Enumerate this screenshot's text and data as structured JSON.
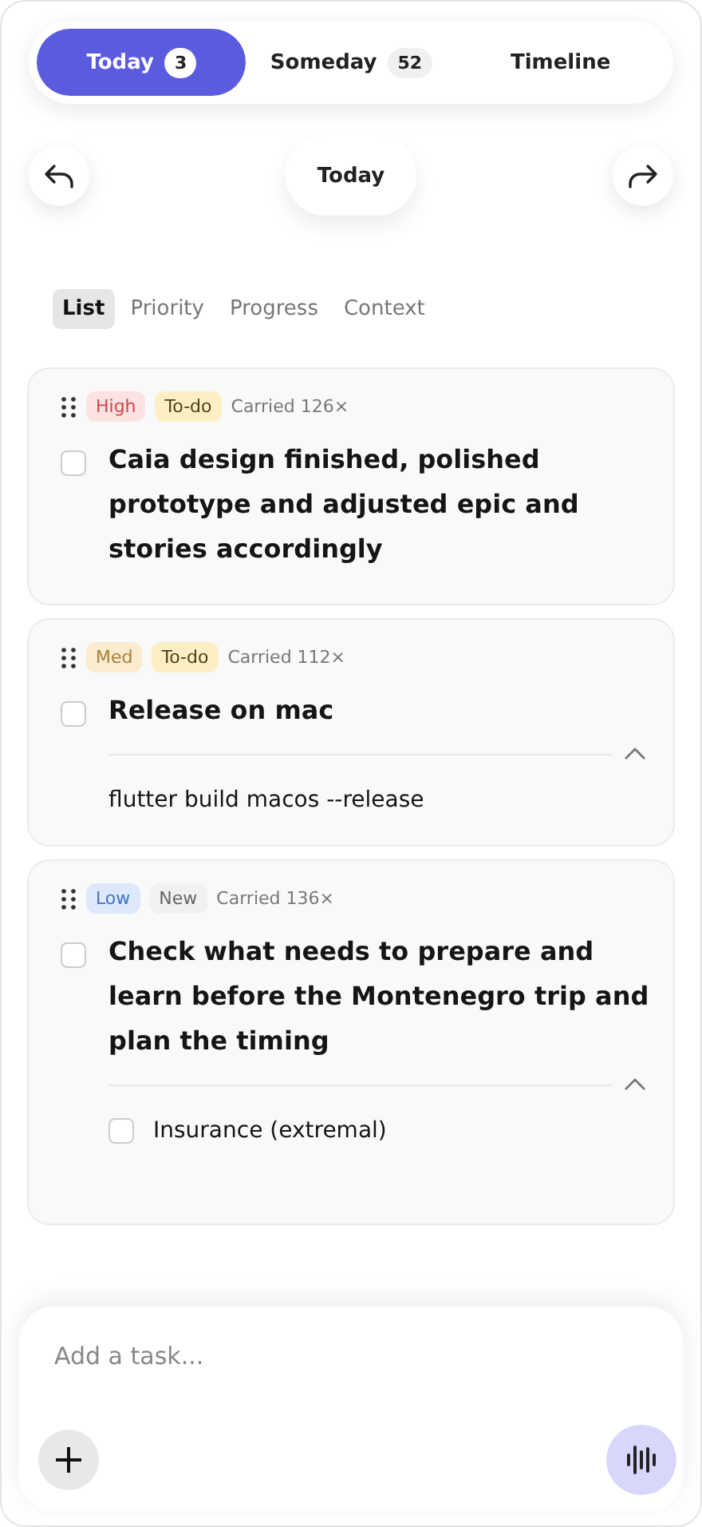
{
  "tabs": [
    {
      "label": "Today",
      "count": "3",
      "selected": true
    },
    {
      "label": "Someday",
      "count": "52",
      "selected": false
    },
    {
      "label": "Timeline",
      "selected": false
    }
  ],
  "day_nav": {
    "label": "Today"
  },
  "views": [
    {
      "label": "List",
      "selected": true
    },
    {
      "label": "Priority",
      "selected": false
    },
    {
      "label": "Progress",
      "selected": false
    },
    {
      "label": "Context",
      "selected": false
    }
  ],
  "tasks": [
    {
      "tags": [
        {
          "label": "High",
          "kind": "high"
        },
        {
          "label": "To-do",
          "kind": "todo"
        }
      ],
      "carried": "Carried 126×",
      "title": "Caia design finished, polished prototype and adjusted epic and stories accordingly",
      "checked": false
    },
    {
      "tags": [
        {
          "label": "Med",
          "kind": "med"
        },
        {
          "label": "To-do",
          "kind": "todo"
        }
      ],
      "carried": "Carried 112×",
      "title": "Release on mac",
      "checked": false,
      "expanded": true,
      "note": "flutter build macos --release"
    },
    {
      "tags": [
        {
          "label": "Low",
          "kind": "low"
        },
        {
          "label": "New",
          "kind": "new"
        }
      ],
      "carried": "Carried 136×",
      "title": "Check what needs to prepare and learn before the Montenegro trip and plan the timing",
      "checked": false,
      "expanded": true,
      "subtasks": [
        {
          "label": "Insurance (extremal)",
          "checked": false
        }
      ]
    }
  ],
  "composer": {
    "placeholder": "Add a task..."
  }
}
